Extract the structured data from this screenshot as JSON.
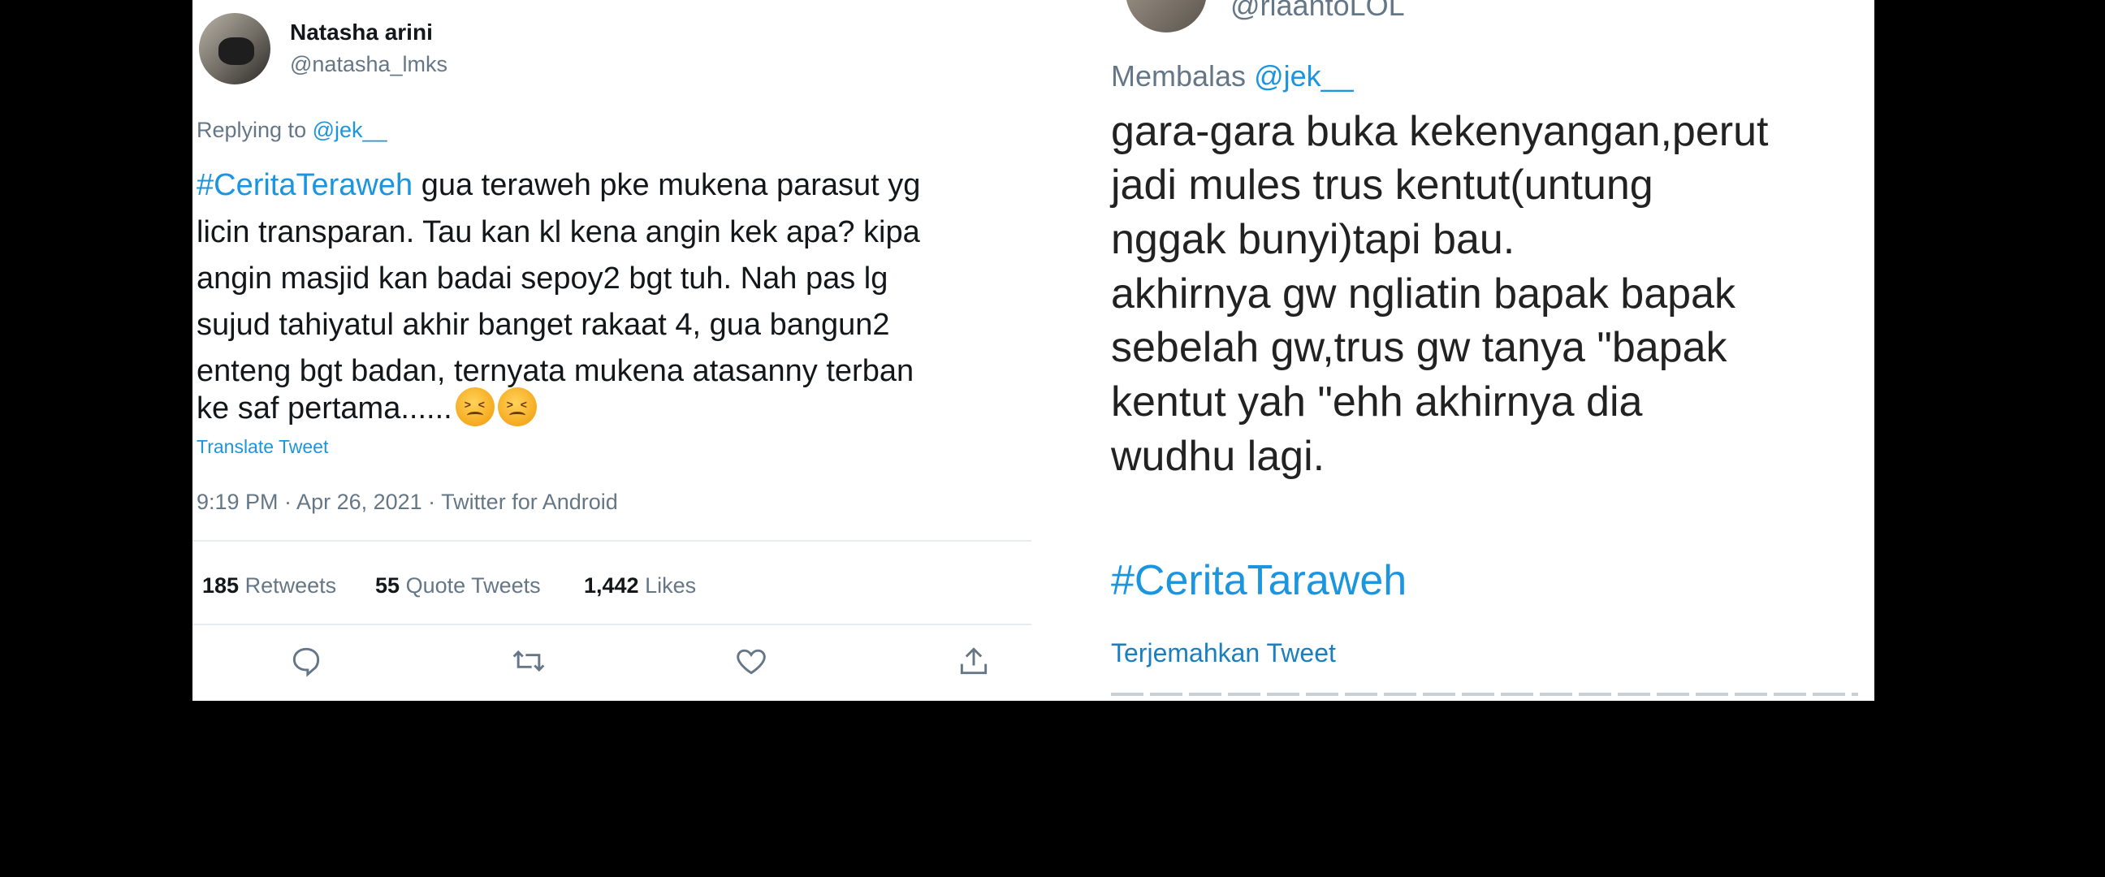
{
  "left_tweet": {
    "display_name": "Natasha arini",
    "handle": "@natasha_lmks",
    "replying_prefix": "Replying to",
    "replying_to": "@jek__",
    "hashtag": "#CeritaTeraweh",
    "lines": [
      "gua teraweh pke mukena parasut yg",
      "licin transparan. Tau kan kl kena angin kek apa? kipa",
      "angin masjid kan badai sepoy2 bgt tuh. Nah pas lg",
      "sujud tahiyatul akhir banget rakaat 4, gua bangun2",
      "enteng bgt badan, ternyata mukena atasanny terban",
      "ke saf pertama......"
    ],
    "translate_label": "Translate Tweet",
    "timestamp": "9:19 PM · Apr 26, 2021 · Twitter for Android",
    "stats": {
      "retweets_count": "185",
      "retweets_label": "Retweets",
      "quotes_count": "55",
      "quotes_label": "Quote Tweets",
      "likes_count": "1,442",
      "likes_label": "Likes"
    },
    "actions": [
      "reply-icon",
      "retweet-icon",
      "like-icon",
      "share-icon"
    ],
    "emoji": "tired-face-emoji"
  },
  "right_tweet": {
    "handle_partial": "@riaantoLOL",
    "replying_prefix": "Membalas",
    "replying_to": "@jek__",
    "lines": [
      "gara-gara buka kekenyangan,perut",
      "jadi mules trus kentut(untung",
      "nggak bunyi)tapi bau.",
      "akhirnya gw ngliatin bapak bapak",
      "sebelah gw,trus gw tanya \"bapak",
      "kentut yah \"ehh akhirnya dia",
      "wudhu lagi."
    ],
    "hashtag": "#CeritaTaraweh",
    "translate_label": "Terjemahkan Tweet"
  },
  "colors": {
    "link": "#1b95e0",
    "muted": "#657786",
    "text": "#14171a",
    "background": "#000000"
  }
}
